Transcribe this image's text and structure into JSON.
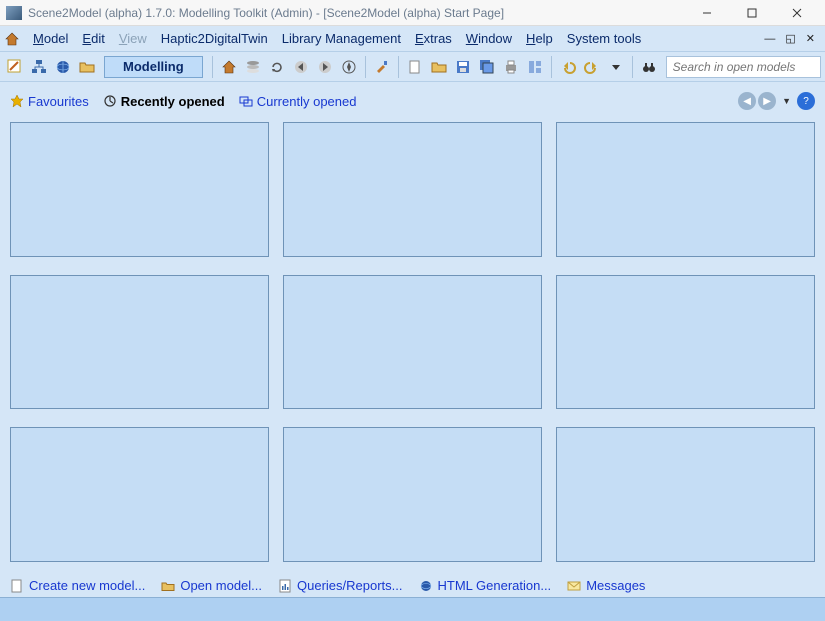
{
  "window": {
    "title": "Scene2Model (alpha) 1.7.0: Modelling Toolkit (Admin) - [Scene2Model (alpha) Start Page]"
  },
  "menu": {
    "model": "Model",
    "edit": "Edit",
    "view": "View",
    "haptic": "Haptic2DigitalTwin",
    "library": "Library Management",
    "extras": "Extras",
    "window": "Window",
    "help": "Help",
    "system": "System tools"
  },
  "toolbar": {
    "mode_label": "Modelling"
  },
  "search": {
    "placeholder": "Search in open models"
  },
  "tabs": {
    "favourites": "Favourites",
    "recent": "Recently opened",
    "current": "Currently opened"
  },
  "bottom": {
    "create": "Create new model...",
    "open": "Open model...",
    "queries": "Queries/Reports...",
    "html": "HTML Generation...",
    "messages": "Messages"
  }
}
